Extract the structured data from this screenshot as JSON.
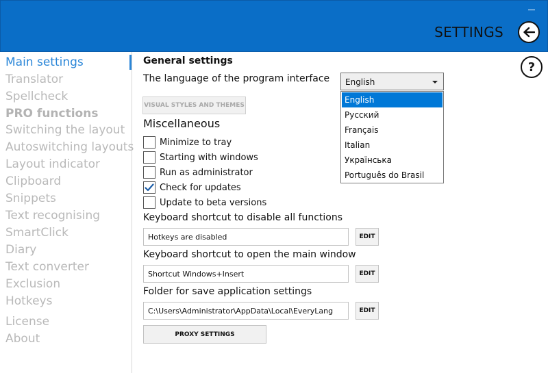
{
  "header": {
    "title": "SETTINGS",
    "accent_color": "#0a6ec7",
    "back_icon": "arrow-left-icon",
    "minimize_icon": "minimize-icon"
  },
  "sidebar": {
    "active_color": "#2a86d8",
    "items": [
      {
        "label": "Main settings"
      },
      {
        "label": "Translator"
      },
      {
        "label": "Spellcheck"
      },
      {
        "label": "PRO functions"
      },
      {
        "label": "Switching the layout"
      },
      {
        "label": "Autoswitching layouts"
      },
      {
        "label": "Layout indicator"
      },
      {
        "label": "Clipboard"
      },
      {
        "label": "Snippets"
      },
      {
        "label": "Text recognising"
      },
      {
        "label": "SmartClick"
      },
      {
        "label": "Diary"
      },
      {
        "label": "Text converter"
      },
      {
        "label": "Exclusion"
      },
      {
        "label": "Hotkeys"
      },
      {
        "label": "License"
      },
      {
        "label": "About"
      }
    ]
  },
  "main": {
    "section_title": "General settings",
    "help_label": "?",
    "language": {
      "label": "The language of the program interface",
      "selected": "English",
      "options": [
        "English",
        "Русский",
        "Français",
        "Italian",
        "Українська",
        "Português do Brasil"
      ]
    },
    "visual_styles_button": "VISUAL STYLES AND THEMES",
    "misc_title": "Miscellaneous",
    "checkboxes": [
      {
        "label": "Minimize to tray",
        "checked": false
      },
      {
        "label": "Starting with windows",
        "checked": false
      },
      {
        "label": "Run as administrator",
        "checked": false
      },
      {
        "label": "Check for updates",
        "checked": true
      },
      {
        "label": "Update to beta versions",
        "checked": false
      }
    ],
    "shortcut_disable": {
      "label": "Keyboard shortcut to disable all functions",
      "value": "Hotkeys are disabled",
      "button": "EDIT"
    },
    "shortcut_open": {
      "label": "Keyboard shortcut to open the main window",
      "value": "Shortcut Windows+Insert",
      "button": "EDIT"
    },
    "folder": {
      "label": "Folder for save application settings",
      "value": "C:\\Users\\Administrator\\AppData\\Local\\EveryLang",
      "button": "EDIT"
    },
    "proxy_button": "PROXY SETTINGS"
  }
}
